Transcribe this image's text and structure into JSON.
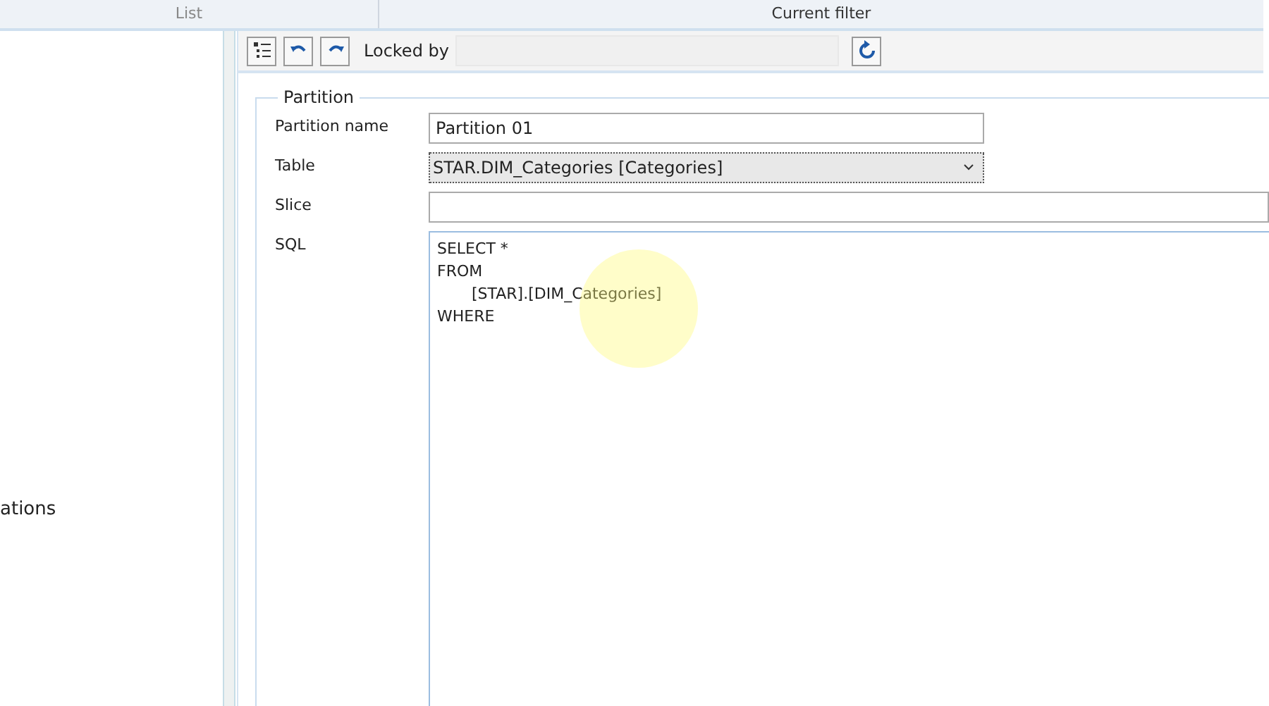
{
  "header": {
    "left": "List",
    "right": "Current filter"
  },
  "sidebar": {
    "items": [
      "ations"
    ]
  },
  "toolbar": {
    "locked_by_label": "Locked by"
  },
  "partition": {
    "title": "Partition",
    "name_label": "Partition name",
    "name_value": "Partition 01",
    "table_label": "Table",
    "table_value": "STAR.DIM_Categories [Categories]",
    "slice_label": "Slice",
    "sql_label": "SQL",
    "sql_value": "SELECT *\nFROM\n\t[STAR].[DIM_Categories]\nWHERE"
  }
}
